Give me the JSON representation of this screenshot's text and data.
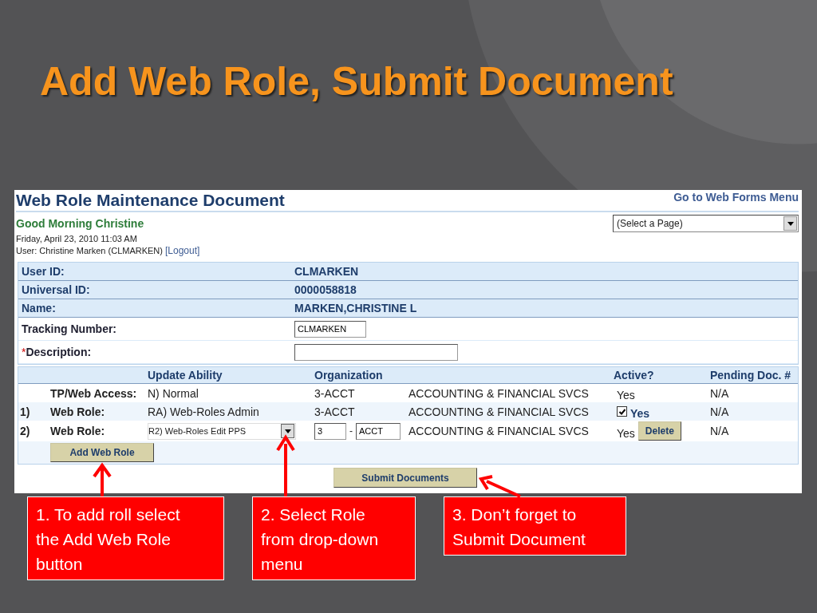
{
  "slide_title": "Add Web Role, Submit Document",
  "document": {
    "title": "Web Role Maintenance Document",
    "menu_link": "Go to Web Forms Menu",
    "greeting": "Good Morning Christine",
    "page_select": "(Select a Page)",
    "date": "Friday, April 23, 2010 11:03 AM",
    "user": "User: Christine Marken (CLMARKEN)",
    "logout": "[Logout]",
    "info_rows": [
      {
        "kind": "text",
        "label": "User ID:",
        "value": "CLMARKEN"
      },
      {
        "kind": "text",
        "label": "Universal ID:",
        "value": "0000058818"
      },
      {
        "kind": "text",
        "label": "Name:",
        "value": "MARKEN,CHRISTINE L"
      },
      {
        "kind": "input",
        "label": "Tracking Number:",
        "value": "CLMARKEN"
      },
      {
        "kind": "input",
        "mark": "*",
        "label": "Description:",
        "value": ""
      }
    ],
    "role_columns": [
      "Update Ability",
      "Organization",
      "Active?",
      "Pending Doc. #"
    ],
    "roles": [
      {
        "kind": "static",
        "label": "TP/Web Access:",
        "ability": "N) Normal",
        "org": "3-ACCT",
        "org_name": "ACCOUNTING & FINANCIAL SVCS",
        "active": "Yes",
        "pending": "N/A"
      },
      {
        "kind": "checkbox",
        "number": "1)",
        "label": "Web Role:",
        "ability": "RA) Web-Roles Admin",
        "org": "3-ACCT",
        "org_name": "ACCOUNTING & FINANCIAL SVCS",
        "checked": true,
        "active": "Yes",
        "pending": "N/A"
      },
      {
        "kind": "edit",
        "number": "2)",
        "label": "Web Role:",
        "ability": "R2) Web-Roles Edit  PPS",
        "org_code": "3",
        "org_sep": "-",
        "org_unit": "ACCT",
        "org_name": "ACCOUNTING & FINANCIAL SVCS",
        "active": "Yes",
        "delete": "Delete",
        "pending": "N/A"
      }
    ],
    "add_button": "Add Web Role",
    "submit_button": "Submit Documents"
  },
  "callouts": [
    {
      "text": "1. To add roll select the Add Web Role button"
    },
    {
      "text": "2. Select Role from drop-down menu"
    },
    {
      "text": "3. Don’t forget to Submit Document"
    }
  ]
}
